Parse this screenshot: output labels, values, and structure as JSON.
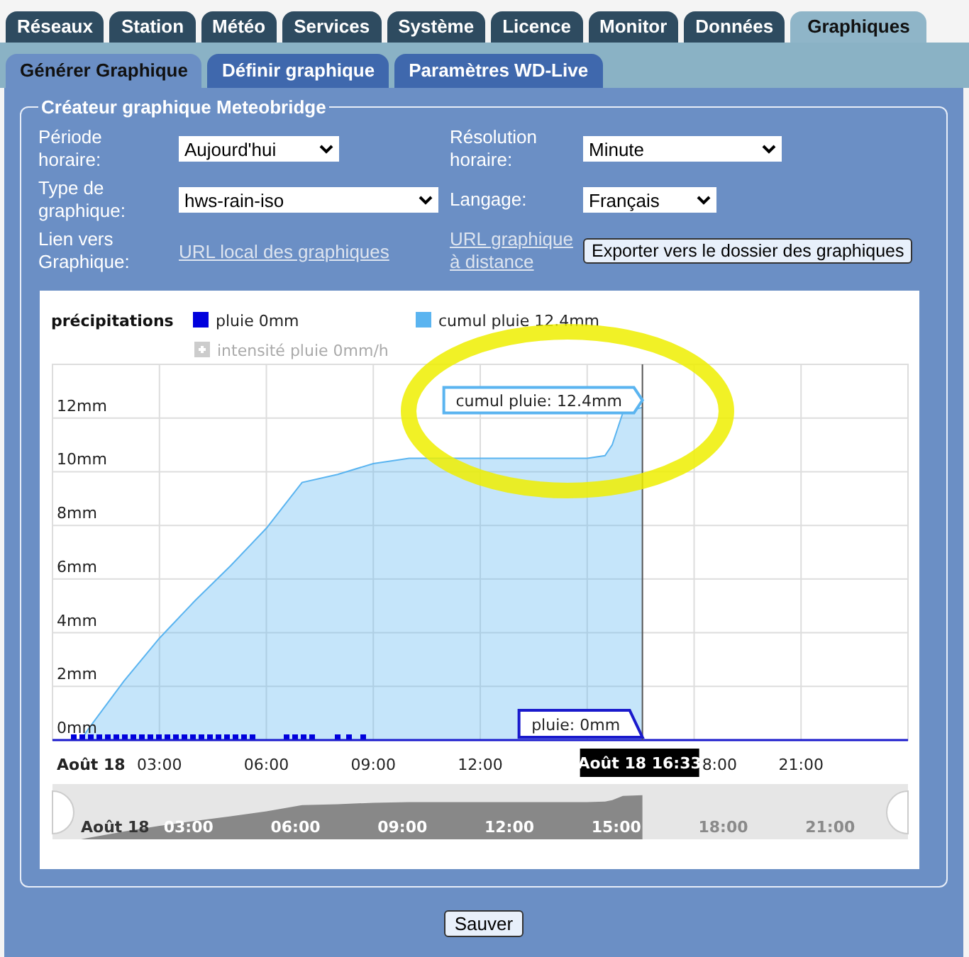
{
  "tabs": [
    {
      "label": "Réseaux",
      "selected": false
    },
    {
      "label": "Station",
      "selected": false
    },
    {
      "label": "Météo",
      "selected": false
    },
    {
      "label": "Services",
      "selected": false
    },
    {
      "label": "Système",
      "selected": false
    },
    {
      "label": "Licence",
      "selected": false
    },
    {
      "label": "Monitor",
      "selected": false
    },
    {
      "label": "Données",
      "selected": false
    },
    {
      "label": "Graphiques",
      "selected": true
    }
  ],
  "subtabs": [
    {
      "label": "Générer Graphique",
      "selected": true
    },
    {
      "label": "Définir graphique",
      "selected": false
    },
    {
      "label": "Paramètres WD-Live",
      "selected": false
    }
  ],
  "panel": {
    "title": "Créateur graphique Meteobridge",
    "fields": [
      {
        "label": "Période horaire:",
        "kind": "select",
        "value": "Aujourd'hui"
      },
      {
        "label": "Résolution horaire:",
        "kind": "select",
        "value": "Minute"
      },
      {
        "label": "Type de graphique:",
        "kind": "select",
        "value": "hws-rain-iso"
      },
      {
        "label": "Langage:",
        "kind": "select",
        "value": "Français"
      },
      {
        "label": "Lien vers Graphique:",
        "kind": "link",
        "value": "URL local des graphiques"
      },
      {
        "label": "URL graphique à distance",
        "kind": "link_label",
        "value": "Exporter vers le dossier des graphiques"
      }
    ],
    "chart": {
      "legend_title": "précipitations",
      "legend": [
        {
          "kind": "plain",
          "label": "pluie",
          "value": "0mm",
          "color": "#0000dd",
          "disabled": false
        },
        {
          "kind": "series",
          "value": "12.4mm",
          "color": "#5ab4f0",
          "disabled": false
        },
        {
          "kind": "plain",
          "label": "intensité pluie",
          "value": "0mm/h",
          "color": "#cccccc",
          "disabled": true
        }
      ],
      "tooltips": [
        {
          "kind": "cumul",
          "text": "cumul pluie: 12.4mm",
          "color": "#5ab4f0"
        },
        {
          "kind": "rain",
          "text": "pluie: 0mm",
          "color": "#1a1acc"
        }
      ],
      "crosshair": {
        "label": "Août 18 16:33"
      },
      "date_label": "Août 18",
      "cut_tick_label": "8:00",
      "chart_data": {
        "type": "area",
        "grid": true,
        "x": [
          0,
          0.8,
          1,
          2,
          3,
          4,
          5,
          6,
          7,
          8,
          9,
          10,
          11,
          12,
          13,
          14,
          15,
          15.5,
          15.7,
          16,
          16.55
        ],
        "series": [
          {
            "name": "cumul pluie",
            "color": "#5ab4f0",
            "values": [
              0,
              0,
              0.4,
              2.2,
              3.8,
              5.2,
              6.5,
              7.9,
              9.6,
              9.9,
              10.3,
              10.5,
              10.5,
              10.5,
              10.5,
              10.5,
              10.5,
              10.6,
              11,
              12.2,
              12.4
            ]
          }
        ],
        "ref_lines": [
          {
            "axis": "x",
            "value": 16.55
          }
        ],
        "xlim": [
          0,
          24
        ],
        "ylim": [
          0,
          14
        ],
        "xticks": [
          {
            "value": 3,
            "label": "03:00"
          },
          {
            "value": 6,
            "label": "06:00"
          },
          {
            "value": 9,
            "label": "09:00"
          },
          {
            "value": 12,
            "label": "12:00"
          },
          {
            "value": 21,
            "label": "21:00"
          }
        ],
        "yticks": [
          {
            "value": 0,
            "label": "0mm"
          },
          {
            "value": 2,
            "label": "2mm"
          },
          {
            "value": 4,
            "label": "4mm"
          },
          {
            "value": 6,
            "label": "6mm"
          },
          {
            "value": 8,
            "label": "8mm"
          },
          {
            "value": 10,
            "label": "10mm"
          },
          {
            "value": 12,
            "label": "12mm"
          }
        ]
      },
      "navigator": {
        "labels": [
          "Août 18",
          "03:00",
          "06:00",
          "09:00",
          "12:00",
          "15:00",
          "18:00",
          "21:00"
        ]
      }
    }
  },
  "save_button": "Sauver"
}
